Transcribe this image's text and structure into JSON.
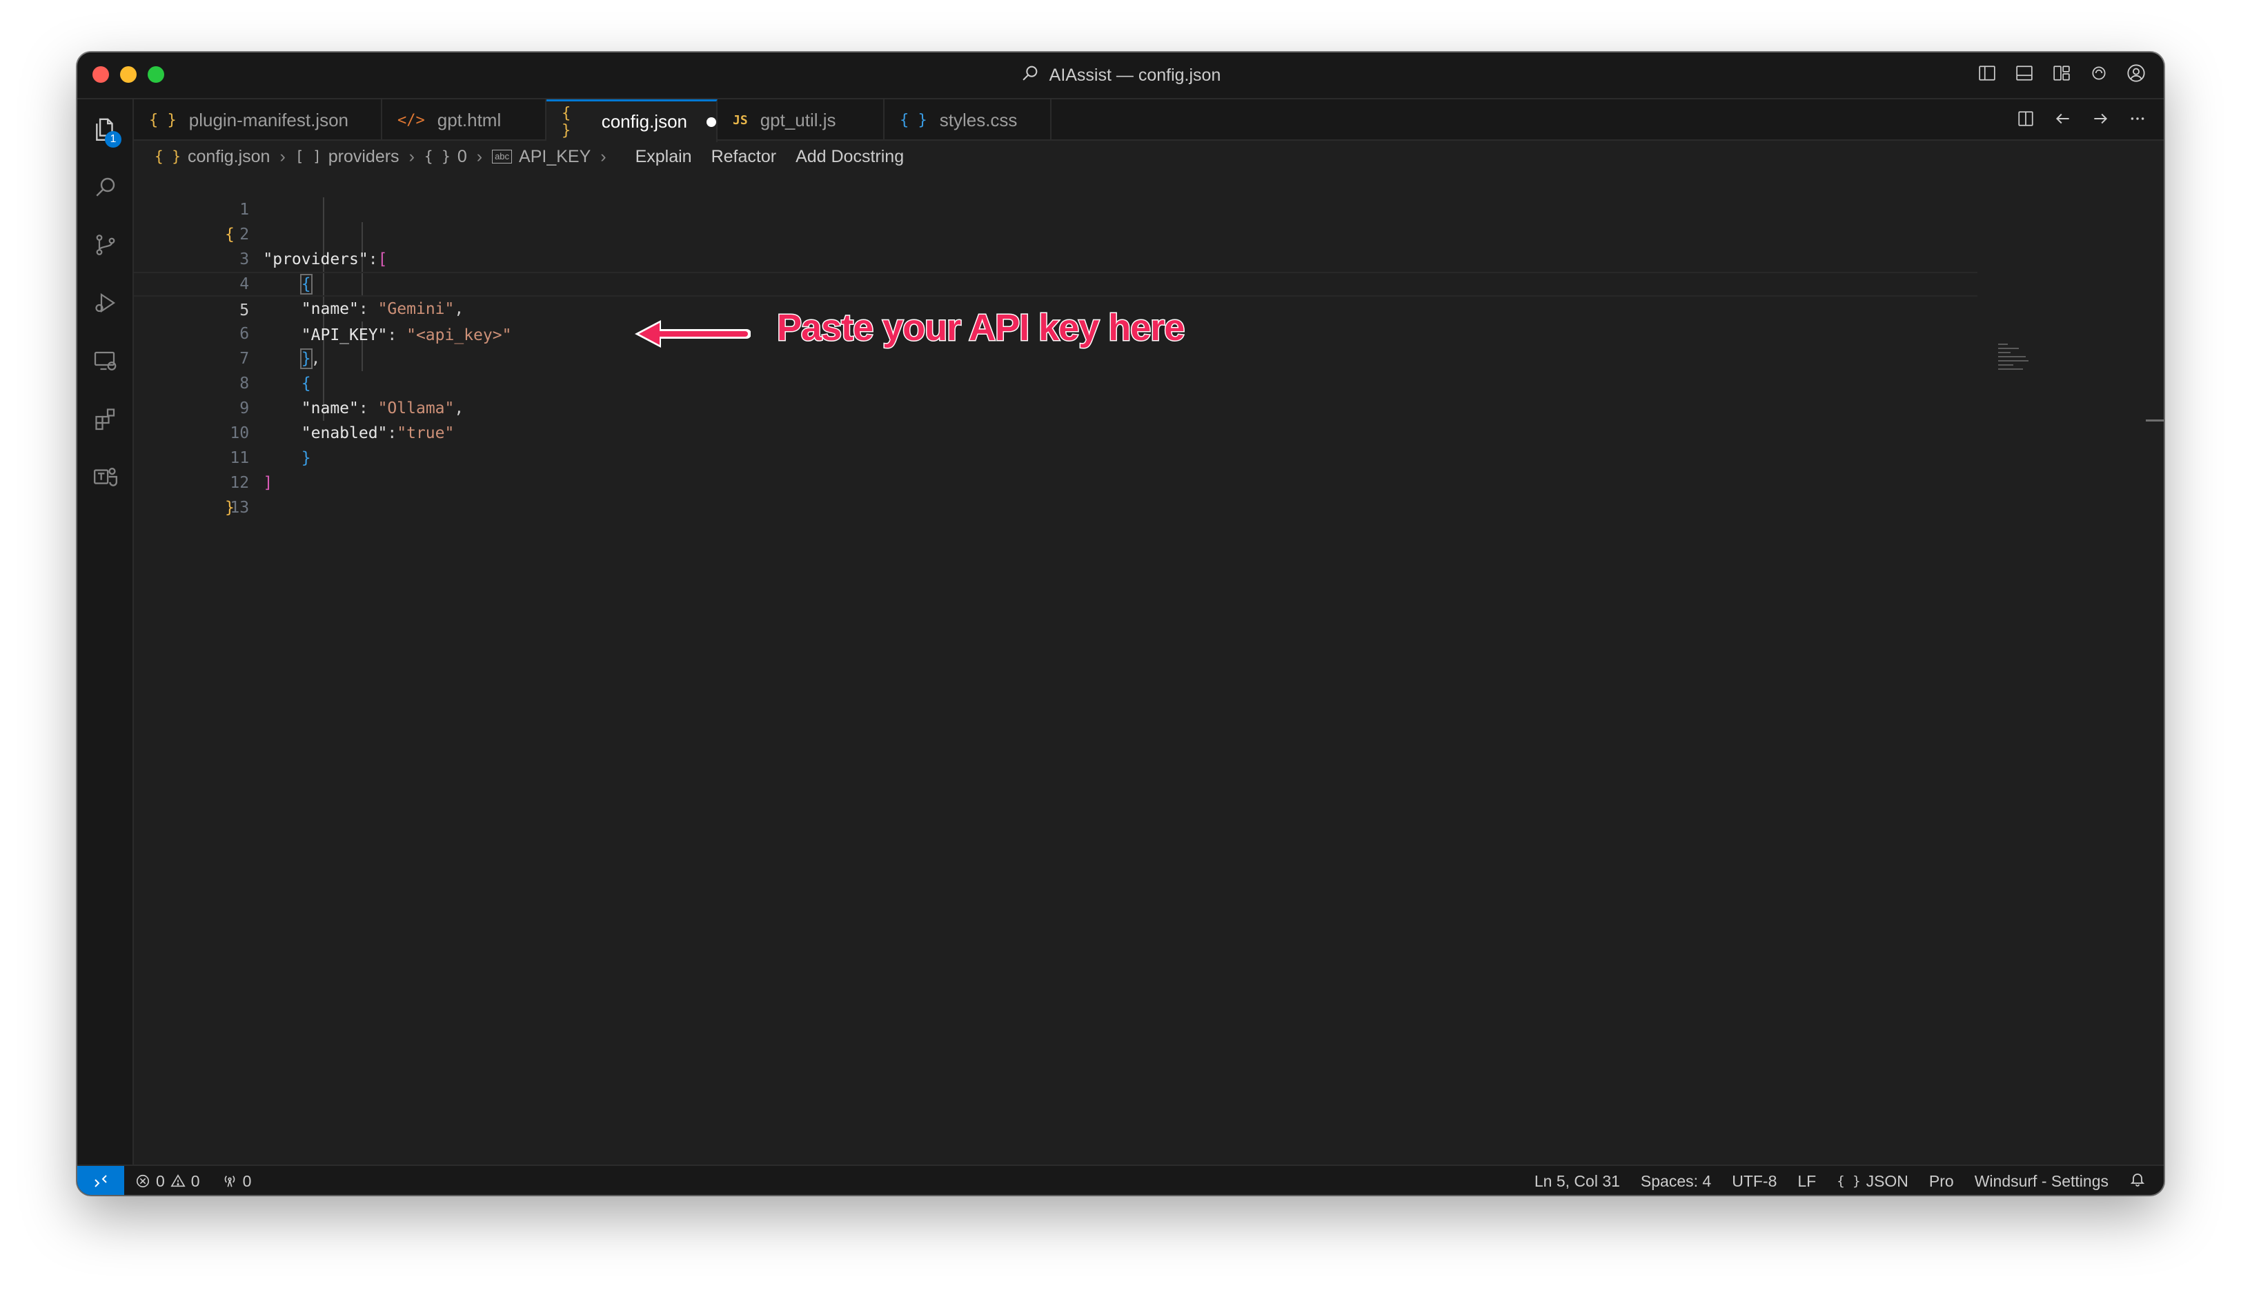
{
  "window": {
    "title": "AIAssist — config.json"
  },
  "activity_bar": {
    "explorer_badge": "1"
  },
  "tabs": [
    {
      "label": "plugin-manifest.json",
      "icon": "{ }",
      "icon_color": "#e8b64a"
    },
    {
      "label": "gpt.html",
      "icon": "</>",
      "icon_color": "#e37933"
    },
    {
      "label": "config.json",
      "icon": "{ }",
      "icon_color": "#e8b64a",
      "active": true,
      "modified": true
    },
    {
      "label": "gpt_util.js",
      "icon": "JS",
      "icon_color": "#e8b64a"
    },
    {
      "label": "styles.css",
      "icon": "{ }",
      "icon_color": "#3a9ee6"
    }
  ],
  "breadcrumb": {
    "file_icon": "{ }",
    "file": "config.json",
    "providers_icon": "[ ]",
    "providers": "providers",
    "index_icon": "{ }",
    "index": "0",
    "key_icon": "abc",
    "key": "API_KEY",
    "actions": [
      "Explain",
      "Refactor",
      "Add Docstring"
    ]
  },
  "editor": {
    "line_numbers": [
      "1",
      "2",
      "3",
      "4",
      "5",
      "6",
      "7",
      "8",
      "9",
      "10",
      "11",
      "12",
      "13"
    ],
    "current_line": 5,
    "code": {
      "l1_brace": "{",
      "l2_key": "\"providers\"",
      "l2_colon": ":",
      "l2_bracket": "[",
      "l3_brace": "{",
      "l4_key": "\"name\"",
      "l4_colon": ": ",
      "l4_value": "\"Gemini\"",
      "l4_comma": ",",
      "l5_key": "\"API_KEY\"",
      "l5_colon": ": ",
      "l5_value": "\"<api_key>\"",
      "l6_brace": "}",
      "l6_comma": ",",
      "l7_brace": "{",
      "l8_key": "\"name\"",
      "l8_colon": ": ",
      "l8_value": "\"Ollama\"",
      "l8_comma": ",",
      "l9_key": "\"enabled\"",
      "l9_colon": ":",
      "l9_value": "\"true\"",
      "l10_brace": "}",
      "l11_bracket": "]",
      "l12_brace": "}"
    }
  },
  "annotation": {
    "text": "Paste your API key here",
    "color": "#f0265a"
  },
  "status_bar": {
    "errors": "0",
    "warnings": "0",
    "ports": "0",
    "cursor": "Ln 5, Col 31",
    "spaces": "Spaces: 4",
    "encoding": "UTF-8",
    "eol": "LF",
    "language_icon": "{ }",
    "language": "JSON",
    "plan": "Pro",
    "settings": "Windsurf - Settings"
  },
  "colors": {
    "accent": "#0078d4",
    "string": "#ce9178",
    "bracket_level1": "#f0b84a",
    "bracket_level2": "#d75ab5",
    "bracket_level3": "#3a9ee6"
  }
}
